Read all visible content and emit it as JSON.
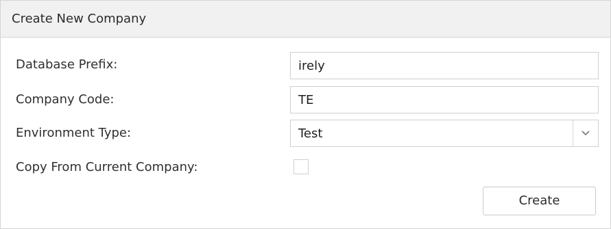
{
  "panel": {
    "title": "Create New Company"
  },
  "form": {
    "database_prefix": {
      "label": "Database Prefix:",
      "value": "irely"
    },
    "company_code": {
      "label": "Company Code:",
      "value": "TE"
    },
    "environment_type": {
      "label": "Environment Type:",
      "value": "Test",
      "icon": "chevron-down-icon"
    },
    "copy_from_current": {
      "label": "Copy From Current Company:",
      "checked": false
    },
    "create_label": "Create"
  }
}
